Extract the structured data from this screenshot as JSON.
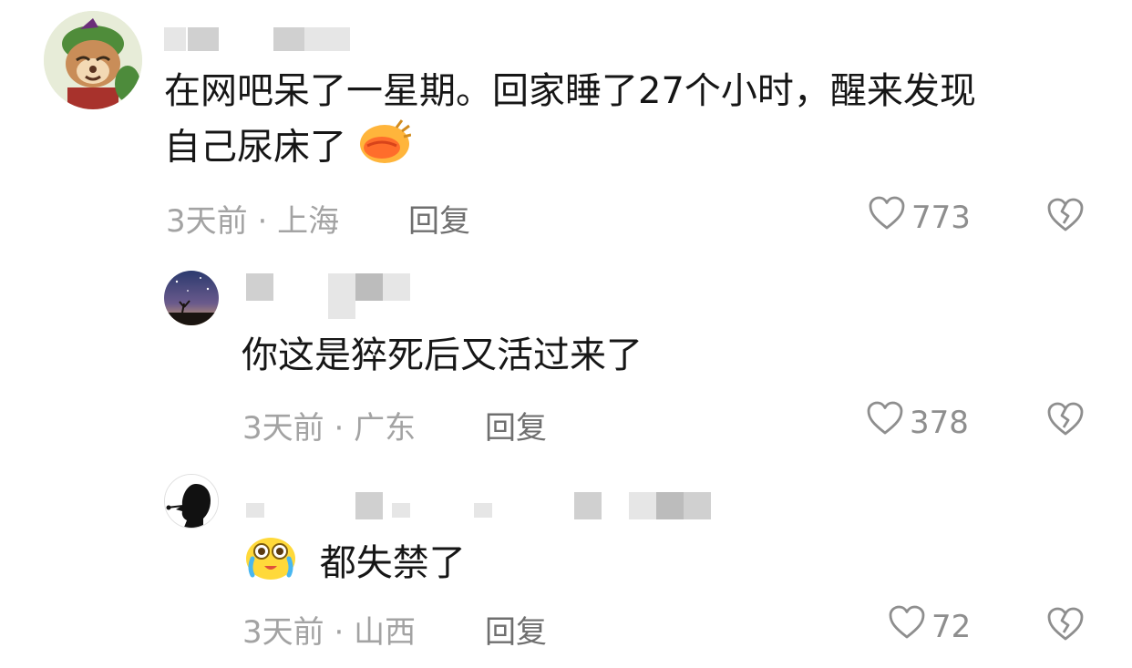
{
  "comments": [
    {
      "avatar_icon": "teemo-avatar",
      "text_line1": "在网吧呆了一星期。回家睡了27个小时，醒来发现",
      "text_line2": "自己尿床了",
      "text_emoji": "duck-face-emoji",
      "time": "3天前",
      "location": "上海",
      "meta_sep": "·",
      "reply_label": "回复",
      "likes": "773"
    },
    {
      "avatar_icon": "starry-night-avatar",
      "text_line1": "你这是猝死后又活过来了",
      "time": "3天前",
      "location": "广东",
      "meta_sep": "·",
      "reply_label": "回复",
      "likes": "378"
    },
    {
      "avatar_icon": "silhouette-avatar",
      "text_emoji": "crying-face-emoji",
      "text_line1": "都失禁了",
      "time": "3天前",
      "location": "山西",
      "meta_sep": "·",
      "reply_label": "回复",
      "likes": "72"
    }
  ],
  "colors": {
    "text": "#161616",
    "meta": "#a3a3a3",
    "reply": "#6f6f6f",
    "icon": "#8e8e8e"
  }
}
